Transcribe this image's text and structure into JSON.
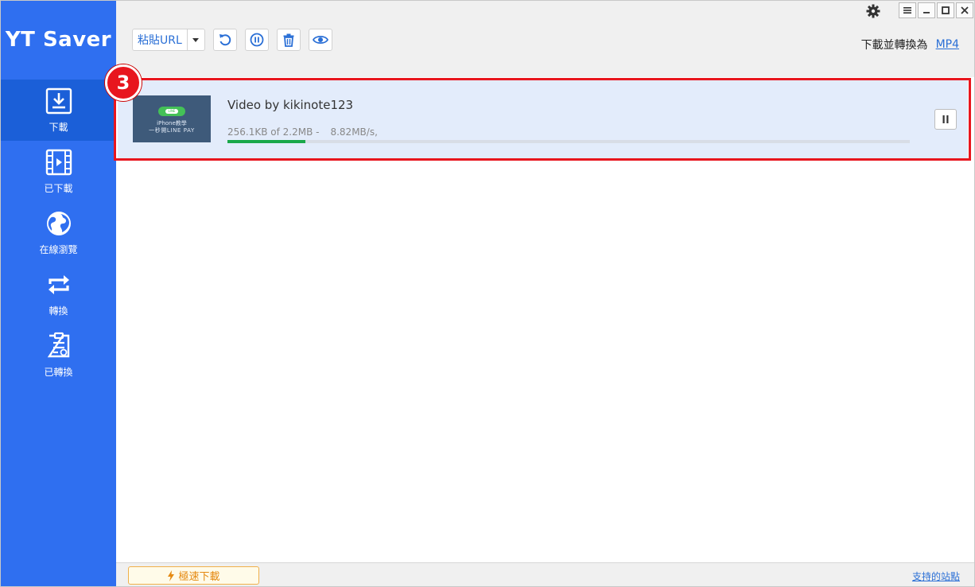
{
  "app": {
    "title": "YT Saver"
  },
  "sidebar": {
    "items": [
      {
        "label": "下載",
        "icon": "download-icon",
        "active": true
      },
      {
        "label": "已下載",
        "icon": "film-icon",
        "active": false
      },
      {
        "label": "在線瀏覽",
        "icon": "globe-icon",
        "active": false
      },
      {
        "label": "轉換",
        "icon": "convert-icon",
        "active": false
      },
      {
        "label": "已轉換",
        "icon": "converted-list-icon",
        "active": false
      }
    ]
  },
  "toolbar": {
    "paste_label": "粘貼URL",
    "convert_label": "下載並轉換為",
    "convert_format": "MP4"
  },
  "download": {
    "title": "Video by kikinote123",
    "progress_text": "256.1KB of 2.2MB -",
    "speed": "8.82MB/s,",
    "progress_fraction": 0.114,
    "thumb_line1": "iPhone教學",
    "thumb_line2": "一秒開LINE PAY",
    "thumb_logo_text": "LINE"
  },
  "annotation": {
    "step": "3"
  },
  "statusbar": {
    "turbo_label": "極速下載",
    "sites_label": "支持的站點"
  },
  "colors": {
    "sidebar": "#2f6ff0",
    "sidebar_active": "#1b5fd8",
    "accent": "#2a6fd6",
    "progress": "#1aa84a",
    "highlight": "#e8161e"
  }
}
